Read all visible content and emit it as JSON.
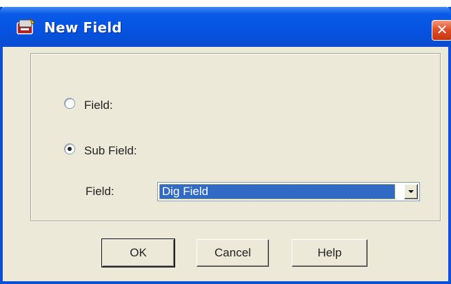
{
  "window": {
    "title": "New Field",
    "close_glyph": "✕"
  },
  "options": {
    "field_label": "Field:",
    "sub_field_label": "Sub Field:",
    "selected": "sub_field"
  },
  "sub_field": {
    "field_label": "Field:",
    "field_value": "Dig Field"
  },
  "buttons": {
    "ok": "OK",
    "cancel": "Cancel",
    "help": "Help"
  },
  "icons": [
    "app-icon",
    "close-icon",
    "dropdown-arrow-icon"
  ],
  "colors": {
    "titlebar": "#0553e0",
    "close": "#e2502a",
    "selection": "#316ac5",
    "face": "#ece9d8"
  }
}
